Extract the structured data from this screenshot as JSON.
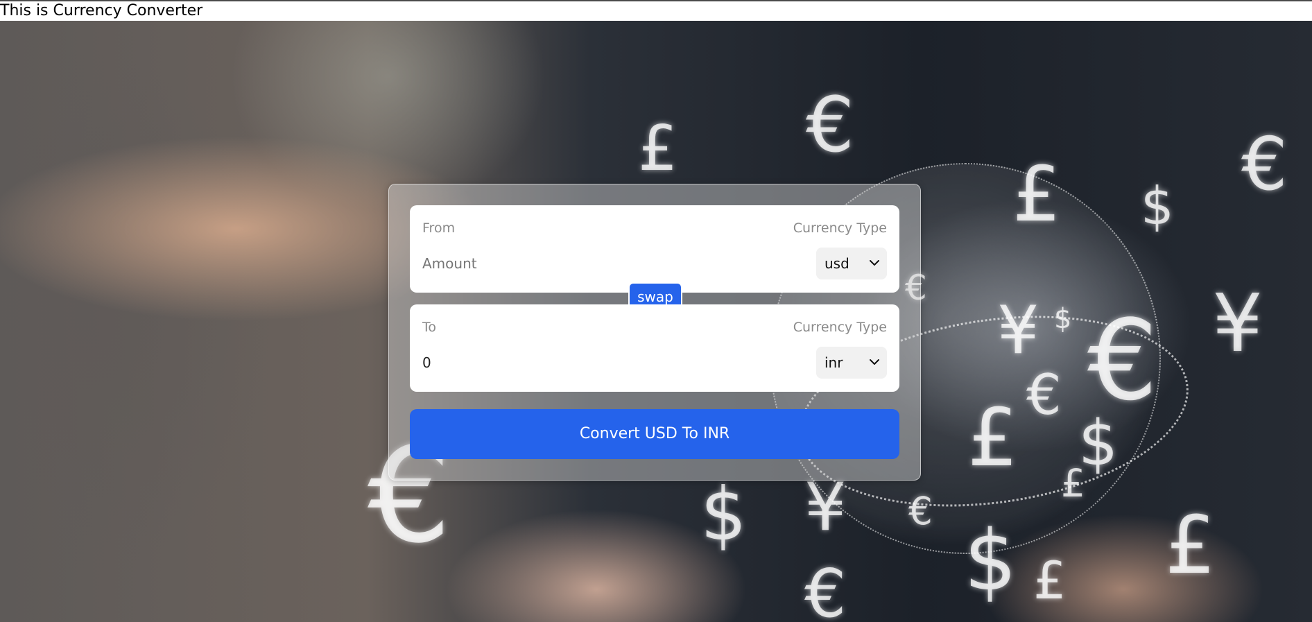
{
  "page": {
    "heading": "This is Currency Converter"
  },
  "converter": {
    "from": {
      "label": "From",
      "currency_type_label": "Currency Type",
      "amount_placeholder": "Amount",
      "amount_value": "",
      "selected_currency": "usd"
    },
    "swap_label": "swap",
    "to": {
      "label": "To",
      "currency_type_label": "Currency Type",
      "amount_value": "0",
      "selected_currency": "inr"
    },
    "convert_label": "Convert USD To INR"
  },
  "background": {
    "symbols": [
      "£",
      "€",
      "€",
      "£",
      "$",
      "€",
      "¥",
      "¥",
      "$",
      "€",
      "€",
      "£",
      "$",
      "£",
      "€",
      "¥",
      "$",
      "£",
      "€",
      "$",
      "£",
      "€"
    ]
  },
  "colors": {
    "accent": "#2563eb",
    "card_background": "#ffffff",
    "muted_text": "#8a8a8a"
  },
  "icons": {
    "select_indicator": "chevron-down-icon"
  }
}
